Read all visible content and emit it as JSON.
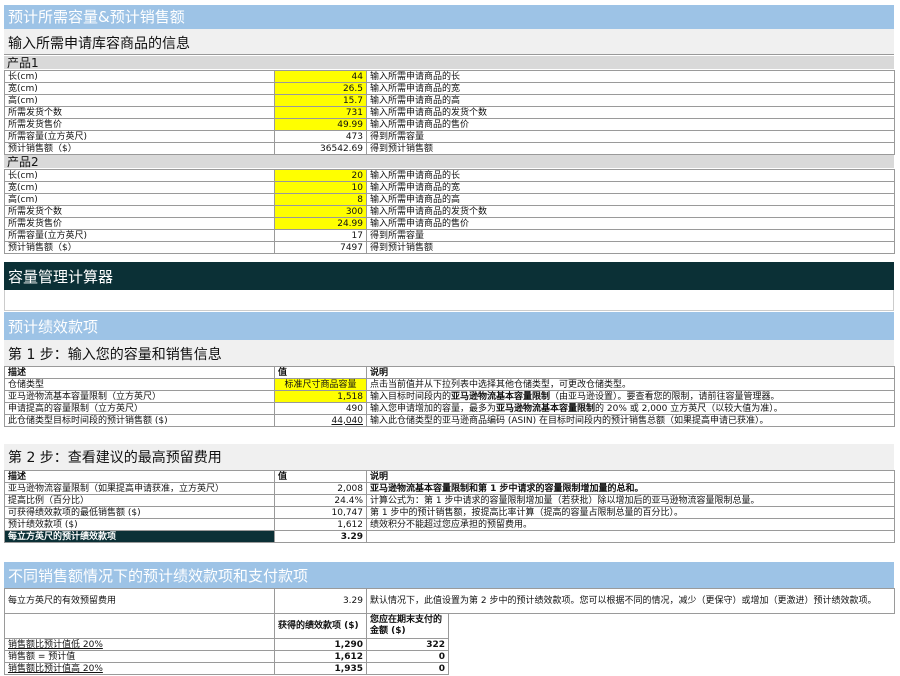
{
  "header1": "预计所需容量&预计销售额",
  "section1_title": "输入所需申请库容商品的信息",
  "products": [
    {
      "name": "产品1",
      "rows": [
        {
          "label": "长(cm)",
          "value": "44",
          "note": "输入所需申请商品的长",
          "input": true
        },
        {
          "label": "宽(cm)",
          "value": "26.5",
          "note": "输入所需申请商品的宽",
          "input": true
        },
        {
          "label": "高(cm)",
          "value": "15.7",
          "note": "输入所需申请商品的高",
          "input": true
        },
        {
          "label": "所需发货个数",
          "value": "731",
          "note": "输入所需申请商品的发货个数",
          "input": true
        },
        {
          "label": "所需发货售价",
          "value": "49.99",
          "note": "输入所需申请商品的售价",
          "input": true
        },
        {
          "label": "所需容量(立方英尺)",
          "value": "473",
          "note": "得到所需容量",
          "input": false
        },
        {
          "label": "预计销售额（$）",
          "value": "36542.69",
          "note": "得到预计销售额",
          "input": false
        }
      ]
    },
    {
      "name": "产品2",
      "rows": [
        {
          "label": "长(cm)",
          "value": "20",
          "note": "输入所需申请商品的长",
          "input": true
        },
        {
          "label": "宽(cm)",
          "value": "10",
          "note": "输入所需申请商品的宽",
          "input": true
        },
        {
          "label": "高(cm)",
          "value": "8",
          "note": "输入所需申请商品的高",
          "input": true
        },
        {
          "label": "所需发货个数",
          "value": "300",
          "note": "输入所需申请商品的发货个数",
          "input": true
        },
        {
          "label": "所需发货售价",
          "value": "24.99",
          "note": "输入所需申请商品的售价",
          "input": true
        },
        {
          "label": "所需容量(立方英尺)",
          "value": "17",
          "note": "得到所需容量",
          "input": false
        },
        {
          "label": "预计销售额（$）",
          "value": "7497",
          "note": "得到预计销售额",
          "input": false
        }
      ]
    }
  ],
  "calc_title": "容量管理计算器",
  "perf_title": "预计绩效款项",
  "step1": {
    "title": "第 1 步：输入您的容量和销售信息",
    "headers": [
      "描述",
      "值",
      "说明"
    ],
    "rows": [
      {
        "label": "仓储类型",
        "value": "标准尺寸商品容量",
        "note": "点击当前值并从下拉列表中选择其他仓储类型，可更改仓储类型。"
      },
      {
        "label": "亚马逊物流基本容量限制（立方英尺）",
        "value": "1,518",
        "note_a": "输入目标时间段内的",
        "note_b": "亚马逊物流基本容量限制",
        "note_c": "（由亚马逊设置）。要查看您的限制，请前往容量管理器。"
      },
      {
        "label": "申请提高的容量限制（立方英尺）",
        "value": "490",
        "note_a": "输入您申请增加的容量，最多为",
        "note_b": "亚马逊物流基本容量限制",
        "note_c": "的 20% 或 2,000 立方英尺（以较大值为准）。"
      },
      {
        "label": "此仓储类型目标时间段的预计销售额 ($)",
        "value": "44,040",
        "note": "输入此仓储类型的亚马逊商品编码 (ASIN) 在目标时间段内的预计销售总额（如果提高申请已获准）。"
      }
    ]
  },
  "step2": {
    "title": "第 2 步：查看建议的最高预留费用",
    "headers": [
      "描述",
      "值",
      "说明"
    ],
    "rows": [
      {
        "label": "亚马逊物流容量限制（如果提高申请获准，立方英尺）",
        "value": "2,008",
        "note": "亚马逊物流基本容量限制和第 1 步中请求的容量限制增加量的总和。"
      },
      {
        "label": "提高比例（百分比）",
        "value": "24.4%",
        "note": "计算公式为：第 1 步中请求的容量限制增加量（若获批）除以增加后的亚马逊物流容量限制总量。"
      },
      {
        "label": "可获得绩效款项的最低销售额 ($)",
        "value": "10,747",
        "note": "第 1 步中的预计销售额，按提高比率计算（提高的容量占限制总量的百分比）。"
      },
      {
        "label": "预计绩效款项 ($)",
        "value": "1,612",
        "note": "绩效积分不能超过您应承担的预留费用。"
      },
      {
        "label": "每立方英尺的预计绩效款项",
        "value": "3.29",
        "note": ""
      }
    ]
  },
  "scenario_title": "不同销售额情况下的预计绩效款项和支付款项",
  "scenario": {
    "fee_label": "每立方英尺的有效预留费用",
    "fee_value": "3.29",
    "fee_note": "默认情况下，此值设置为第 2 步中的预计绩效款项。您可以根据不同的情况，减少（更保守）或增加（更激进）预计绩效款项。",
    "col1": "获得的绩效款项 ($)",
    "col2": "您应在期末支付的金额 ($)",
    "rows": [
      {
        "label": "销售额比预计值低 20%",
        "v1": "1,290",
        "v2": "322"
      },
      {
        "label": "销售额 = 预计值",
        "v1": "1,612",
        "v2": "0"
      },
      {
        "label": "销售额比预计值高 20%",
        "v1": "1,935",
        "v2": "0"
      }
    ]
  }
}
